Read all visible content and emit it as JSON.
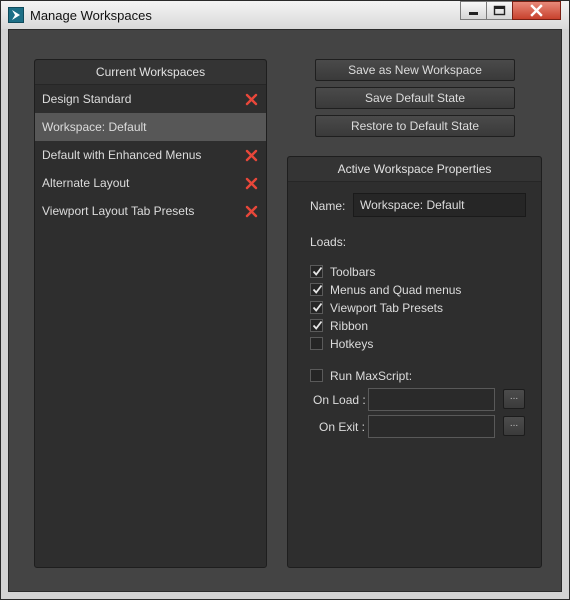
{
  "window": {
    "title": "Manage Workspaces",
    "minimize_icon": "minimize-icon",
    "maximize_icon": "maximize-icon",
    "close_icon": "close-icon"
  },
  "workspaces": {
    "header": "Current Workspaces",
    "items": [
      {
        "label": "Design Standard",
        "deletable": true,
        "selected": false
      },
      {
        "label": "Workspace: Default",
        "deletable": false,
        "selected": true
      },
      {
        "label": "Default with Enhanced Menus",
        "deletable": true,
        "selected": false
      },
      {
        "label": "Alternate Layout",
        "deletable": true,
        "selected": false
      },
      {
        "label": "Viewport Layout Tab Presets",
        "deletable": true,
        "selected": false
      }
    ],
    "delete_icon": "delete-x-icon",
    "delete_color": "#e8473a"
  },
  "actions": {
    "save_new": "Save as New Workspace",
    "save_default": "Save Default State",
    "restore_default": "Restore to Default State"
  },
  "properties": {
    "header": "Active Workspace Properties",
    "name_label": "Name:",
    "name_value": "Workspace: Default",
    "loads_label": "Loads:",
    "loads": [
      {
        "label": "Toolbars",
        "checked": true
      },
      {
        "label": "Menus and Quad menus",
        "checked": true
      },
      {
        "label": "Viewport Tab Presets",
        "checked": true
      },
      {
        "label": "Ribbon",
        "checked": true
      },
      {
        "label": "Hotkeys",
        "checked": false
      }
    ],
    "run_maxscript": {
      "label": "Run MaxScript:",
      "checked": false
    },
    "on_load_label": "On Load :",
    "on_load_value": "",
    "on_exit_label": "On Exit :",
    "on_exit_value": "",
    "browse_label": "..."
  }
}
